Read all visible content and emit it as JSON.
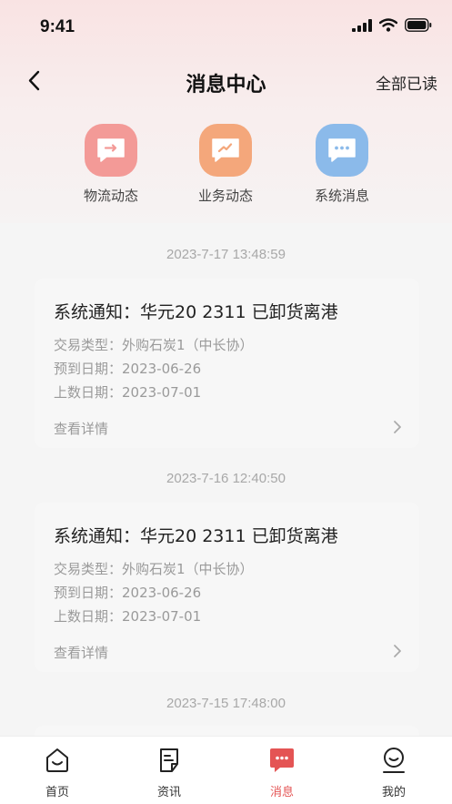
{
  "status_bar": {
    "time": "9:41"
  },
  "nav": {
    "title": "消息中心",
    "read_all": "全部已读"
  },
  "categories": [
    {
      "label": "物流动态",
      "icon": "logistics-icon",
      "color": "#f39a97"
    },
    {
      "label": "业务动态",
      "icon": "business-trend-icon",
      "color": "#f4a77b"
    },
    {
      "label": "系统消息",
      "icon": "system-message-icon",
      "color": "#8bbaea"
    }
  ],
  "messages": [
    {
      "date": "2023-7-17 13:48:59",
      "title": "系统通知：华元20 2311 已卸货离港",
      "trade_type": "交易类型：外购石炭1（中长协）",
      "arrival_date": "预到日期：2023-06-26",
      "record_date": "上数日期：2023-07-01",
      "link": "查看详情"
    },
    {
      "date": "2023-7-16 12:40:50",
      "title": "系统通知：华元20 2311 已卸货离港",
      "trade_type": "交易类型：外购石炭1（中长协）",
      "arrival_date": "预到日期：2023-06-26",
      "record_date": "上数日期：2023-07-01",
      "link": "查看详情"
    },
    {
      "date": "2023-7-15 17:48:00"
    }
  ],
  "tabs": [
    {
      "label": "首页",
      "icon": "home-icon"
    },
    {
      "label": "资讯",
      "icon": "news-icon"
    },
    {
      "label": "消息",
      "icon": "message-icon",
      "active": true
    },
    {
      "label": "我的",
      "icon": "profile-icon"
    }
  ],
  "colors": {
    "accent": "#e45454",
    "muted_text": "#9a9a9a"
  }
}
